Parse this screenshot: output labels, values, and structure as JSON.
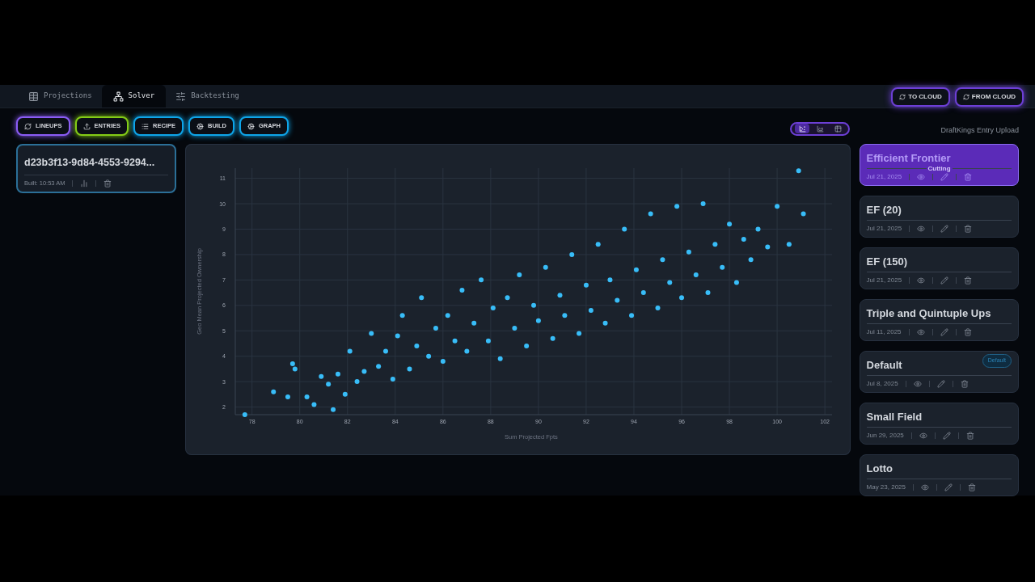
{
  "tabs": [
    {
      "label": "Projections",
      "kind": "table",
      "selected": false
    },
    {
      "label": "Solver",
      "kind": "network",
      "selected": true
    },
    {
      "label": "Backtesting",
      "kind": "sliders",
      "selected": false
    }
  ],
  "cloud_buttons": [
    {
      "label": "TO CLOUD"
    },
    {
      "label": "FROM CLOUD"
    }
  ],
  "toolbar": [
    {
      "label": "LINEUPS",
      "kind": "refresh",
      "color": "#8b5cf6"
    },
    {
      "label": "ENTRIES",
      "kind": "upload",
      "color": "#84cc16"
    },
    {
      "label": "RECIPE",
      "kind": "list",
      "color": "#0ea5e9"
    },
    {
      "label": "BUILD",
      "kind": "cog",
      "color": "#0ea5e9"
    },
    {
      "label": "GRAPH",
      "kind": "cog",
      "color": "#0ea5e9"
    }
  ],
  "view_toggle": [
    {
      "kind": "scatter",
      "selected": true
    },
    {
      "kind": "area",
      "selected": false
    },
    {
      "kind": "table",
      "selected": false
    }
  ],
  "upload_label": "DraftKings Entry Upload",
  "build": {
    "id": "d23b3f13-9d84-4553-9294...",
    "built": "Built: 10:53 AM"
  },
  "chart": {
    "chart_data": {
      "type": "scatter",
      "grid": true,
      "xlabel": "Sum Projected Fpts",
      "ylabel": "Geo Mean Projected Ownership",
      "xlim": [
        77.3,
        102.3
      ],
      "ylim": [
        1.7,
        11.4
      ],
      "xticks": [
        78,
        80,
        82,
        84,
        86,
        88,
        90,
        92,
        94,
        96,
        98,
        100,
        102
      ],
      "yticks": [
        2,
        3,
        4,
        5,
        6,
        7,
        8,
        9,
        10,
        11
      ],
      "x": [
        77.7,
        78.9,
        79.5,
        79.7,
        79.8,
        80.3,
        80.6,
        80.9,
        81.2,
        81.4,
        81.6,
        81.9,
        82.1,
        82.4,
        82.7,
        83.0,
        83.3,
        83.6,
        83.9,
        84.1,
        84.3,
        84.6,
        84.9,
        85.1,
        85.4,
        85.7,
        86.0,
        86.2,
        86.5,
        86.8,
        87.0,
        87.3,
        87.6,
        87.9,
        88.1,
        88.4,
        88.7,
        89.0,
        89.2,
        89.5,
        89.8,
        90.0,
        90.3,
        90.6,
        90.9,
        91.1,
        91.4,
        91.7,
        92.0,
        92.2,
        92.5,
        92.8,
        93.0,
        93.3,
        93.6,
        93.9,
        94.1,
        94.4,
        94.7,
        95.0,
        95.2,
        95.5,
        95.8,
        96.0,
        96.3,
        96.6,
        96.9,
        97.1,
        97.4,
        97.7,
        98.0,
        98.3,
        98.6,
        98.9,
        99.2,
        99.6,
        100.0,
        100.5,
        100.9,
        101.1
      ],
      "series": [
        {
          "color": "#38bdf8",
          "values": [
            1.7,
            2.6,
            2.4,
            3.7,
            3.5,
            2.4,
            2.1,
            3.2,
            2.9,
            1.9,
            3.3,
            2.5,
            4.2,
            3.0,
            3.4,
            4.9,
            3.6,
            4.2,
            3.1,
            4.8,
            5.6,
            3.5,
            4.4,
            6.3,
            4.0,
            5.1,
            3.8,
            5.6,
            4.6,
            6.6,
            4.2,
            5.3,
            7.0,
            4.6,
            5.9,
            3.9,
            6.3,
            5.1,
            7.2,
            4.4,
            6.0,
            5.4,
            7.5,
            4.7,
            6.4,
            5.6,
            8.0,
            4.9,
            6.8,
            5.8,
            8.4,
            5.3,
            7.0,
            6.2,
            9.0,
            5.6,
            7.4,
            6.5,
            9.6,
            5.9,
            7.8,
            6.9,
            9.9,
            6.3,
            8.1,
            7.2,
            10.0,
            6.5,
            8.4,
            7.5,
            9.2,
            6.9,
            8.6,
            7.8,
            9.0,
            8.3,
            9.9,
            8.4,
            11.3,
            9.6
          ]
        }
      ]
    }
  },
  "recipes": [
    {
      "name": "Efficient Frontier",
      "date": "Jul 21, 2025",
      "selected": true,
      "overlay": "Cutting"
    },
    {
      "name": "EF (20)",
      "date": "Jul 21, 2025",
      "selected": false
    },
    {
      "name": "EF (150)",
      "date": "Jul 21, 2025",
      "selected": false
    },
    {
      "name": "Triple and Quintuple Ups",
      "date": "Jul 11, 2025",
      "selected": false
    },
    {
      "name": "Default",
      "date": "Jul 8, 2025",
      "selected": false,
      "badge": "Default"
    },
    {
      "name": "Small Field",
      "date": "Jun 29, 2025",
      "selected": false
    },
    {
      "name": "Lotto",
      "date": "May 23, 2025",
      "selected": false
    }
  ]
}
